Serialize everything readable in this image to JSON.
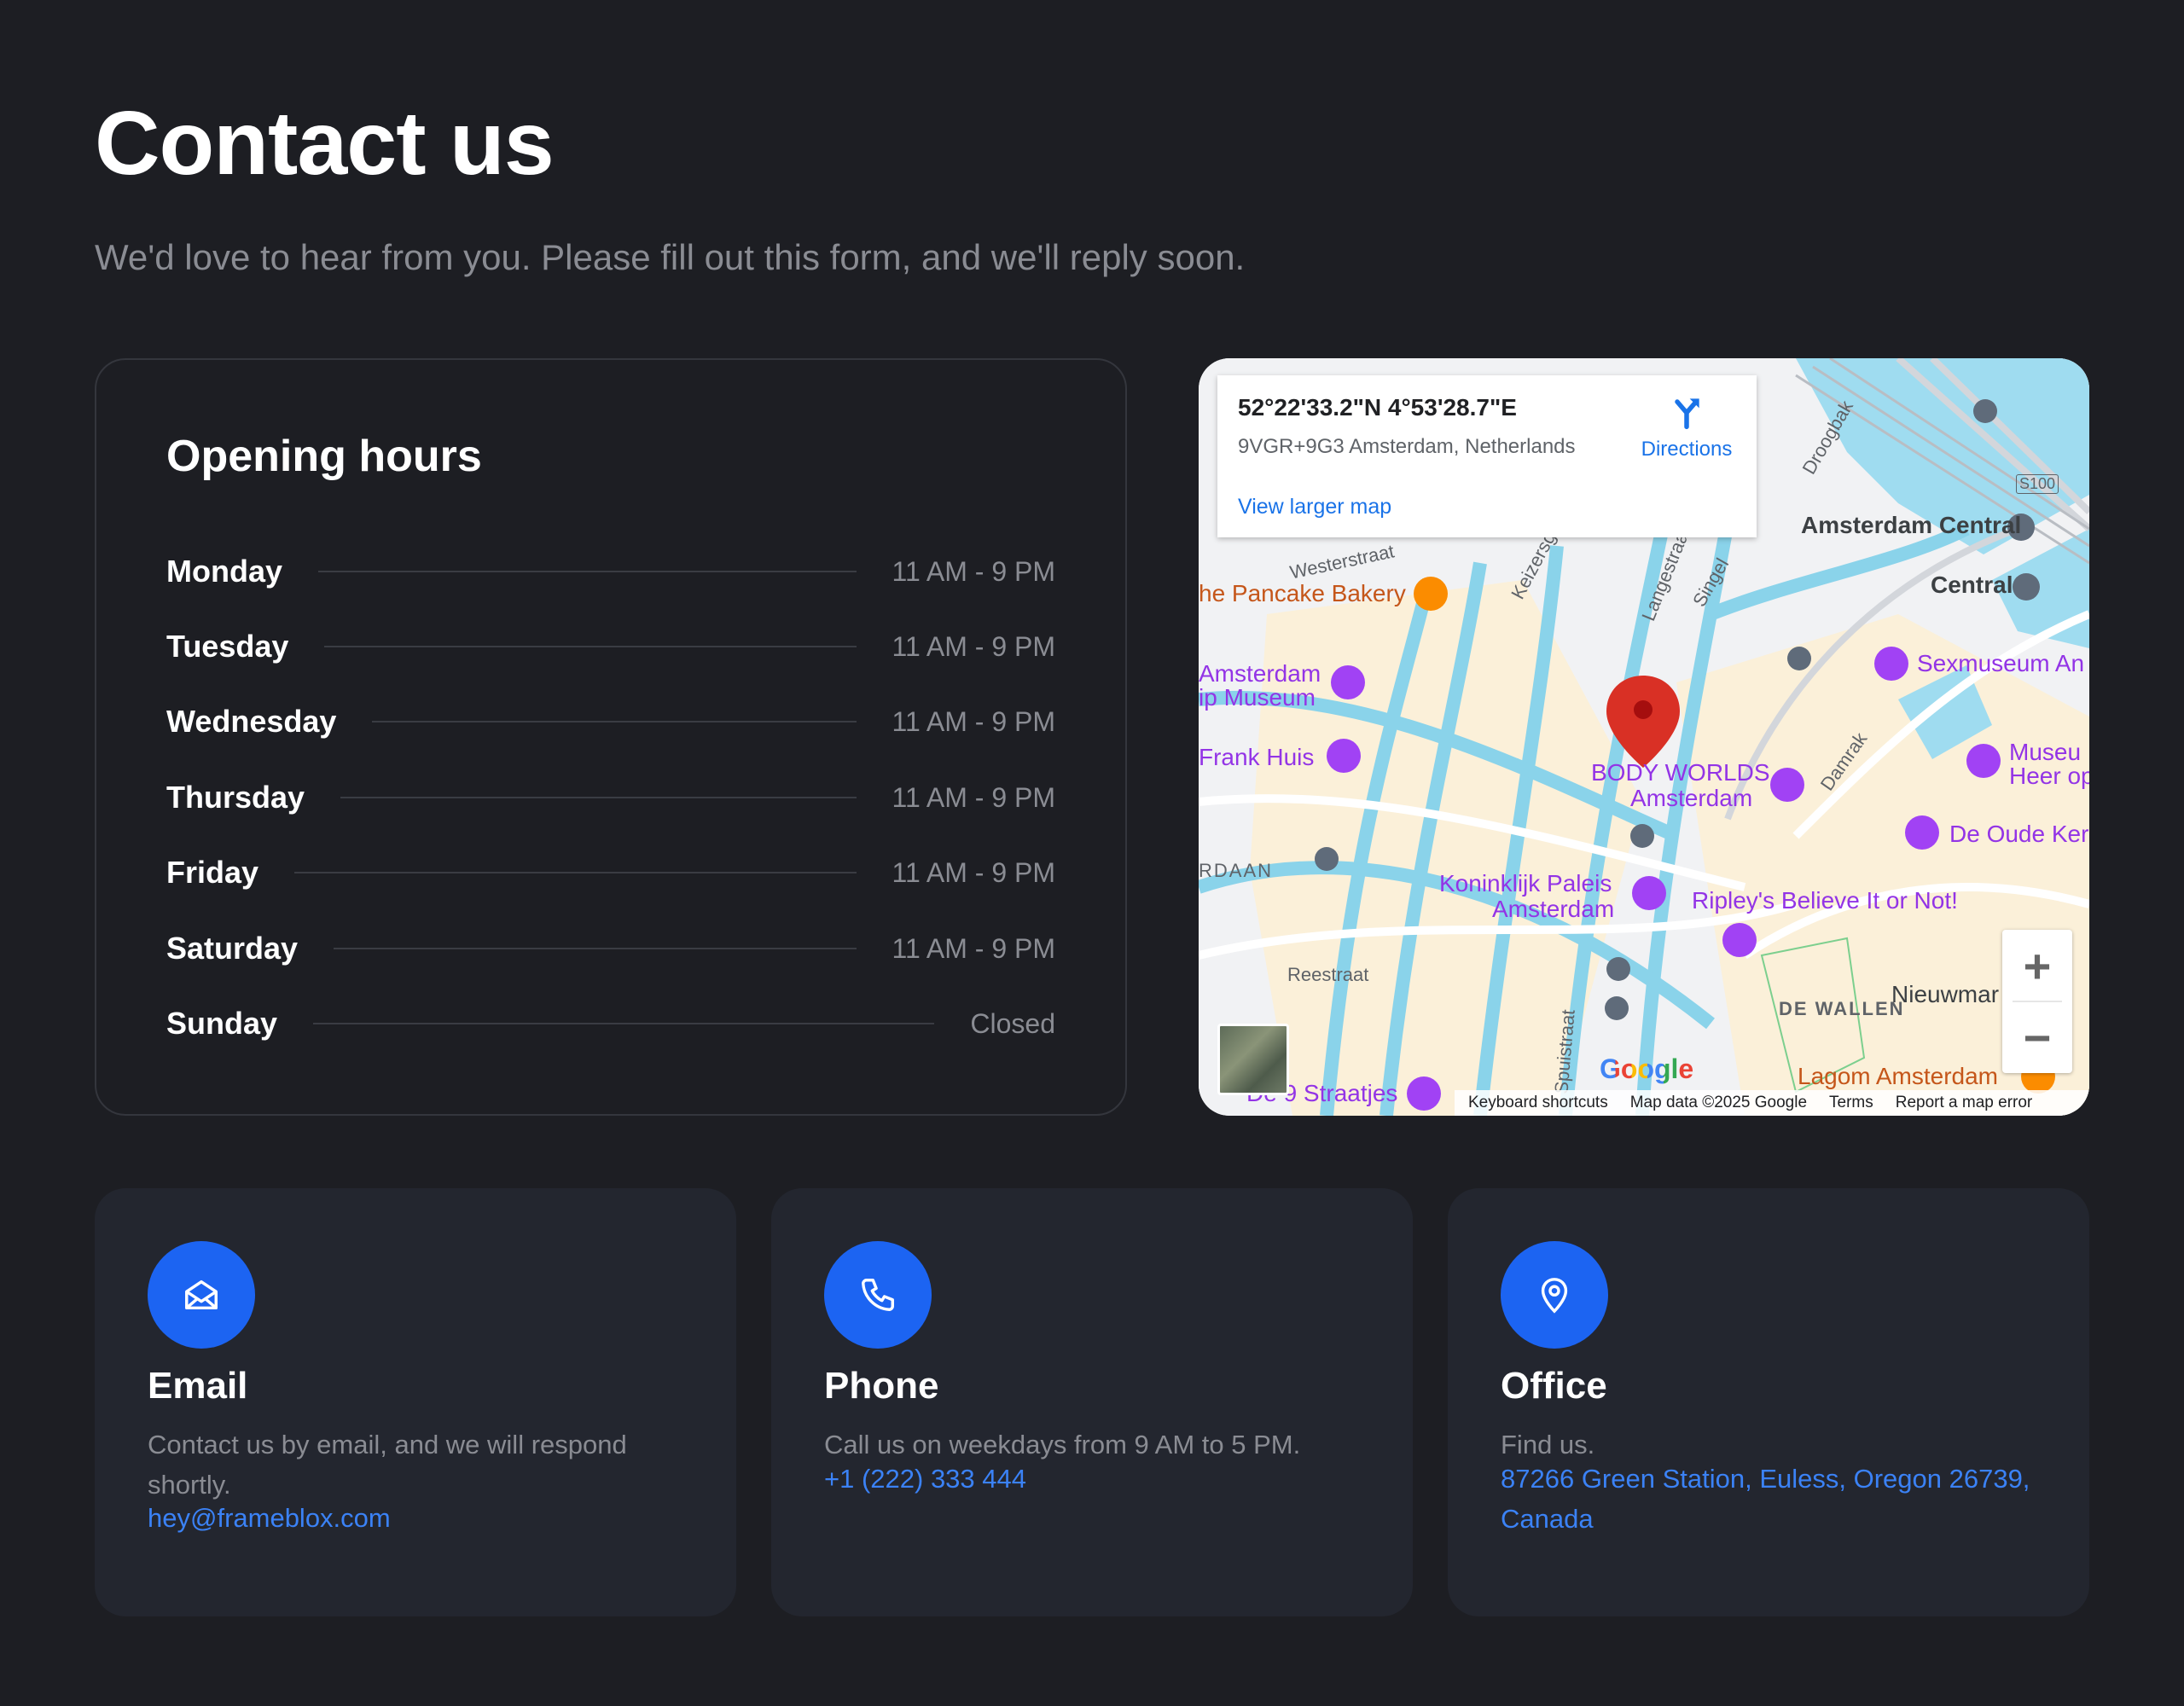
{
  "header": {
    "title": "Contact us",
    "subtitle": "We'd love to hear from you. Please fill out this form, and we'll reply soon."
  },
  "hours": {
    "title": "Opening hours",
    "rows": [
      {
        "day": "Monday",
        "time": "11 AM - 9 PM"
      },
      {
        "day": "Tuesday",
        "time": "11 AM - 9 PM"
      },
      {
        "day": "Wednesday",
        "time": "11 AM - 9 PM"
      },
      {
        "day": "Thursday",
        "time": "11 AM - 9 PM"
      },
      {
        "day": "Friday",
        "time": "11 AM - 9 PM"
      },
      {
        "day": "Saturday",
        "time": "11 AM - 9 PM"
      },
      {
        "day": "Sunday",
        "time": "Closed"
      }
    ]
  },
  "map": {
    "coords": "52°22'33.2\"N 4°53'28.7\"E",
    "address": "9VGR+9G3 Amsterdam, Netherlands",
    "directions_label": "Directions",
    "view_larger": "View larger map",
    "labels": {
      "pancake": "he Pancake Bakery",
      "amsterdam_central": "Amsterdam Central",
      "central": "Central",
      "sexmuseum": "Sexmuseum An",
      "tulip1": "Amsterdam",
      "tulip2": "ip Museum",
      "frank": "Frank Huis",
      "bodyworlds1": "BODY WORLDS",
      "bodyworlds2": "Amsterdam",
      "museum1": "Museu",
      "museum2": "Heer op",
      "oudekerk": "De Oude Ker",
      "paleis1": "Koninklijk Paleis",
      "paleis2": "Amsterdam",
      "ripley": "Ripley's Believe It or Not!",
      "nieuwmar": "Nieuwmar",
      "dewallen": "DE WALLEN",
      "lagom": "Lagom Amsterdam",
      "straatjes": "De 9 Straatjes",
      "westerstraat": "Westerstraat",
      "keizersg": "Keizersg",
      "langestraat": "Langestraat",
      "singel": "Singel",
      "droogbak": "Droogbak",
      "damrak": "Damrak",
      "reestraat": "Reestraat",
      "rdaan": "RDAAN",
      "spuistraat": "Spuistraat",
      "s100": "S100"
    },
    "zoom_in": "+",
    "zoom_out": "−",
    "google": "Google",
    "footer": {
      "shortcuts": "Keyboard shortcuts",
      "mapdata": "Map data ©2025 Google",
      "terms": "Terms",
      "report": "Report a map error"
    }
  },
  "contact": {
    "email": {
      "title": "Email",
      "desc": "Contact us by email, and we will respond shortly.",
      "link": "hey@frameblox.com",
      "icon": "mail-open-icon"
    },
    "phone": {
      "title": "Phone",
      "desc": "Call us on weekdays from 9 AM to 5 PM.",
      "link": "+1 (222) 333 444",
      "icon": "phone-icon"
    },
    "office": {
      "title": "Office",
      "desc": "Find us.",
      "link": "87266 Green Station, Euless, Oregon 26739, Canada",
      "icon": "map-pin-icon"
    }
  },
  "colors": {
    "background": "#1d1e23",
    "card": "#23262f",
    "accent": "#1c64f2",
    "link": "#3b82f6",
    "muted": "#8a8c93"
  }
}
